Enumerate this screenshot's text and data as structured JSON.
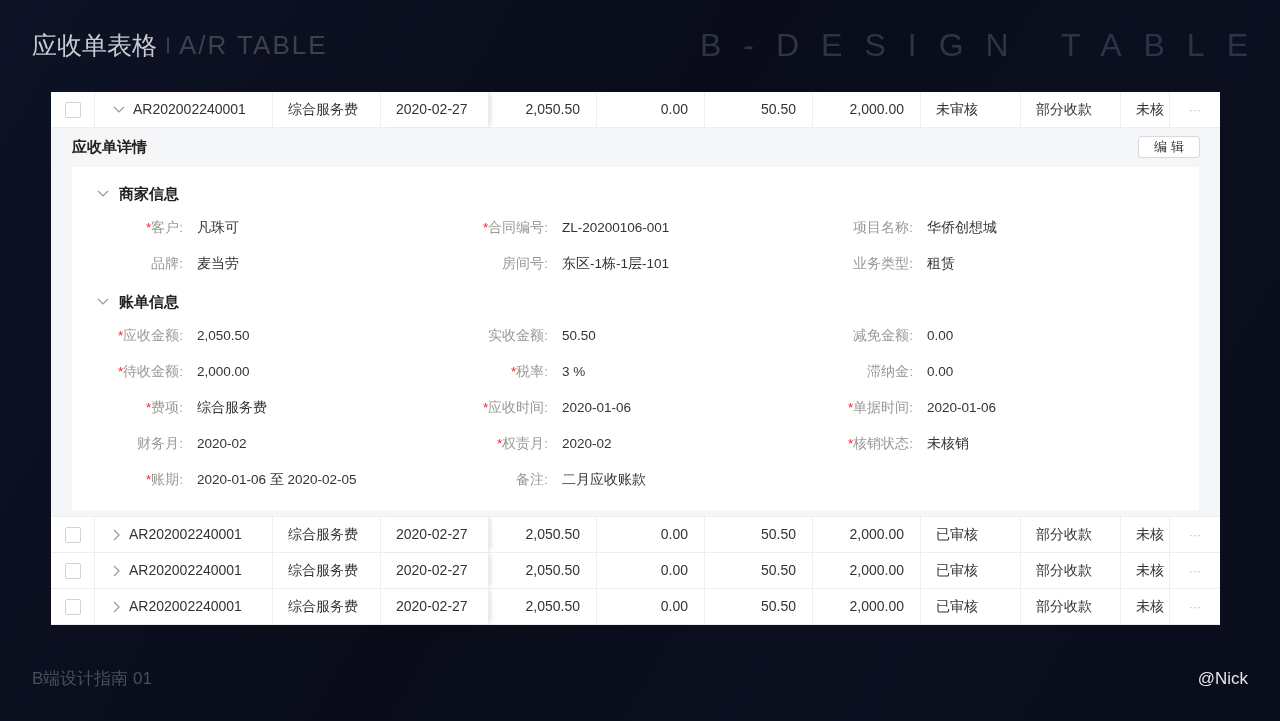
{
  "slide": {
    "title": "应收单表格",
    "subtitle": "A/R TABLE",
    "watermark_title": "B-DESIGN TABLE",
    "footer_left": "B端设计指南 01",
    "footer_right": "@Nick"
  },
  "table": {
    "rows": [
      {
        "checked": false,
        "expanded": true,
        "cells": [
          "AR202002240001",
          "综合服务费",
          "2020-02-27",
          "2,050.50",
          "0.00",
          "50.50",
          "2,000.00",
          "未审核",
          "部分收款",
          "未核"
        ],
        "actions": "···"
      },
      {
        "checked": false,
        "expanded": false,
        "cells": [
          "AR202002240001",
          "综合服务费",
          "2020-02-27",
          "2,050.50",
          "0.00",
          "50.50",
          "2,000.00",
          "已审核",
          "部分收款",
          "未核"
        ],
        "actions": "···"
      },
      {
        "checked": false,
        "expanded": false,
        "cells": [
          "AR202002240001",
          "综合服务费",
          "2020-02-27",
          "2,050.50",
          "0.00",
          "50.50",
          "2,000.00",
          "已审核",
          "部分收款",
          "未核"
        ],
        "actions": "···"
      },
      {
        "checked": false,
        "expanded": false,
        "cells": [
          "AR202002240001",
          "综合服务费",
          "2020-02-27",
          "2,050.50",
          "0.00",
          "50.50",
          "2,000.00",
          "已审核",
          "部分收款",
          "未核"
        ],
        "actions": "···"
      }
    ]
  },
  "detail": {
    "title": "应收单详情",
    "edit_button": "编 辑",
    "sections": [
      {
        "title": "商家信息",
        "expanded": true,
        "fields": [
          {
            "required_mark": "*",
            "label": "客户:",
            "value": "凡珠可"
          },
          {
            "required_mark": "*",
            "label": "合同编号:",
            "value": "ZL-20200106-001"
          },
          {
            "label": "项目名称:",
            "value": "华侨创想城"
          },
          {
            "label": "品牌:",
            "value": "麦当劳"
          },
          {
            "label": "房间号:",
            "value": "东区-1栋-1层-101"
          },
          {
            "label": "业务类型:",
            "value": "租赁"
          }
        ]
      },
      {
        "title": "账单信息",
        "expanded": true,
        "fields": [
          {
            "required_mark": "*",
            "label": "应收金额:",
            "value": "2,050.50"
          },
          {
            "label": "实收金额:",
            "value": "50.50"
          },
          {
            "label": "减免金额:",
            "value": "0.00"
          },
          {
            "required_mark": "*",
            "label": "待收金额:",
            "value": "2,000.00"
          },
          {
            "required_mark": "*",
            "label": "税率:",
            "value": "3 %"
          },
          {
            "label": "滞纳金:",
            "value": "0.00"
          },
          {
            "required_mark": "*",
            "label": "费项:",
            "value": "综合服务费"
          },
          {
            "required_mark": "*",
            "label": "应收时间:",
            "value": "2020-01-06"
          },
          {
            "required_mark": "*",
            "label": "单据时间:",
            "value": "2020-01-06"
          },
          {
            "label": "财务月:",
            "value": "2020-02"
          },
          {
            "required_mark": "*",
            "label": "权责月:",
            "value": "2020-02"
          },
          {
            "required_mark": "*",
            "label": "核销状态:",
            "value": "未核销"
          },
          {
            "required_mark": "*",
            "label": "账期:",
            "value": "2020-01-06 至 2020-02-05"
          },
          {
            "label": "备注:",
            "value": "二月应收账款"
          }
        ]
      }
    ]
  }
}
